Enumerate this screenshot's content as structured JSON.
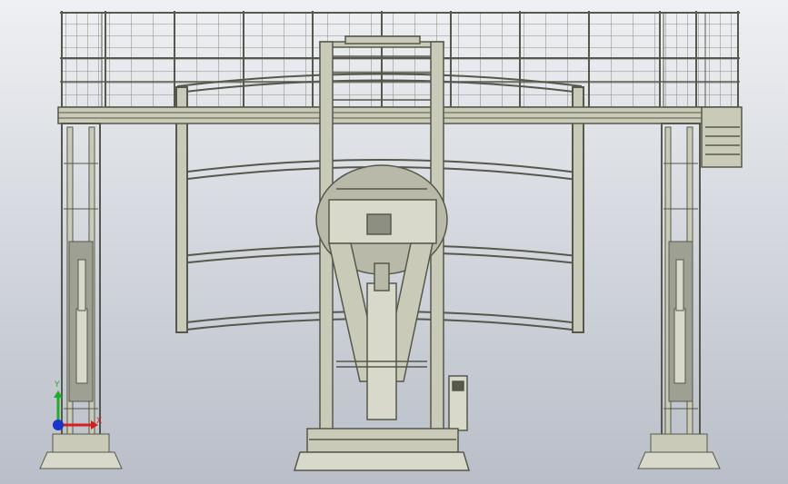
{
  "viewport": {
    "background_top": "#eef0f3",
    "background_bottom": "#b9bec8",
    "frame_color": "#55584a",
    "frame_fill": "#c9cab8",
    "rail_color": "#6b6e63"
  },
  "triad": {
    "x_label": "X",
    "y_label": "Y",
    "x_color": "#d21e1e",
    "y_color": "#1fae2a",
    "z_color": "#1a35c9"
  }
}
